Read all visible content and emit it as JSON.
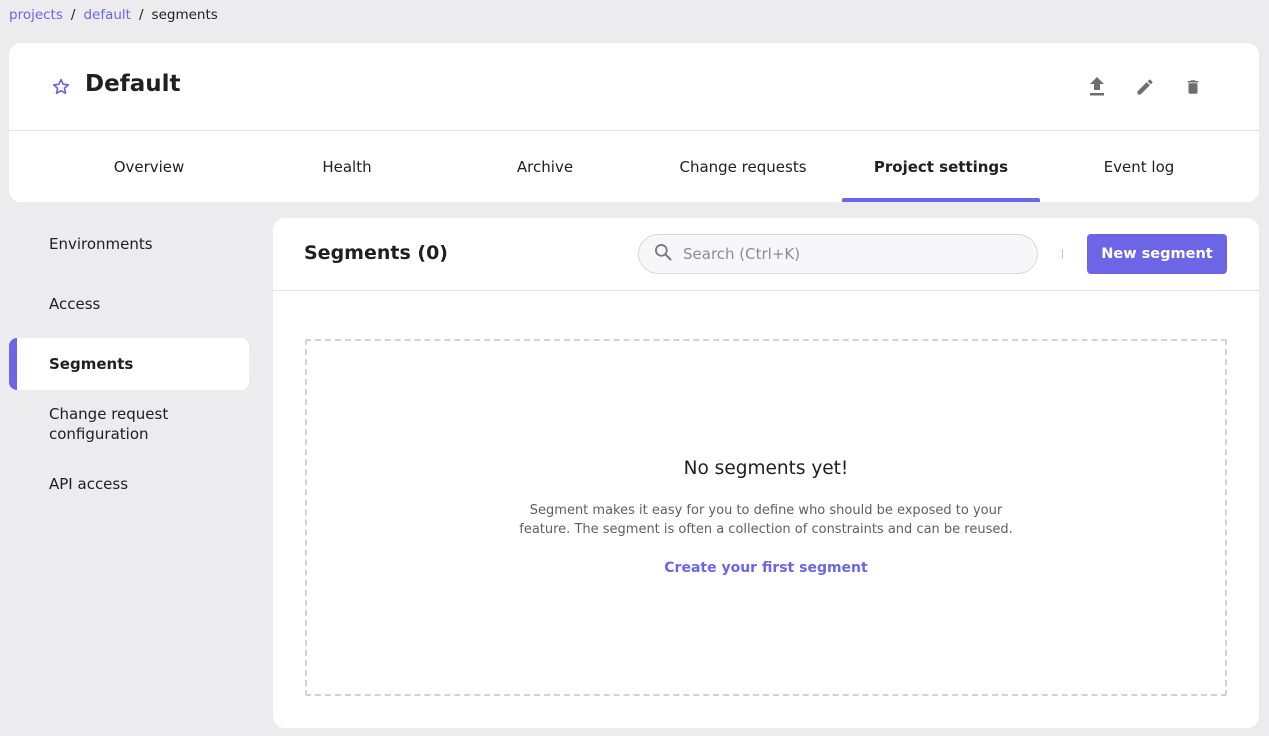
{
  "breadcrumb": {
    "items": [
      {
        "label": "projects"
      },
      {
        "label": "default"
      },
      {
        "label": "segments"
      }
    ],
    "separator": "/"
  },
  "header": {
    "title": "Default",
    "icons": [
      "star-icon",
      "export-icon",
      "edit-icon",
      "delete-icon"
    ]
  },
  "tabs": [
    {
      "label": "Overview",
      "active": false
    },
    {
      "label": "Health",
      "active": false
    },
    {
      "label": "Archive",
      "active": false
    },
    {
      "label": "Change requests",
      "active": false
    },
    {
      "label": "Project settings",
      "active": true
    },
    {
      "label": "Event log",
      "active": false
    }
  ],
  "sidebar": {
    "items": [
      {
        "label": "Environments",
        "active": false
      },
      {
        "label": "Access",
        "active": false
      },
      {
        "label": "Segments",
        "active": true
      },
      {
        "label": "Change request configuration",
        "active": false
      },
      {
        "label": "API access",
        "active": false
      }
    ]
  },
  "main": {
    "title": "Segments (0)",
    "search": {
      "placeholder": "Search (Ctrl+K)",
      "value": ""
    },
    "new_button": "New segment",
    "empty": {
      "title": "No segments yet!",
      "description": "Segment makes it easy for you to define who should be exposed to your feature. The segment is often a collection of constraints and can be reused.",
      "link": "Create your first segment"
    }
  },
  "colors": {
    "accent": "#6c65e5",
    "background": "#ececef",
    "card": "#ffffff",
    "text": "#202021"
  }
}
